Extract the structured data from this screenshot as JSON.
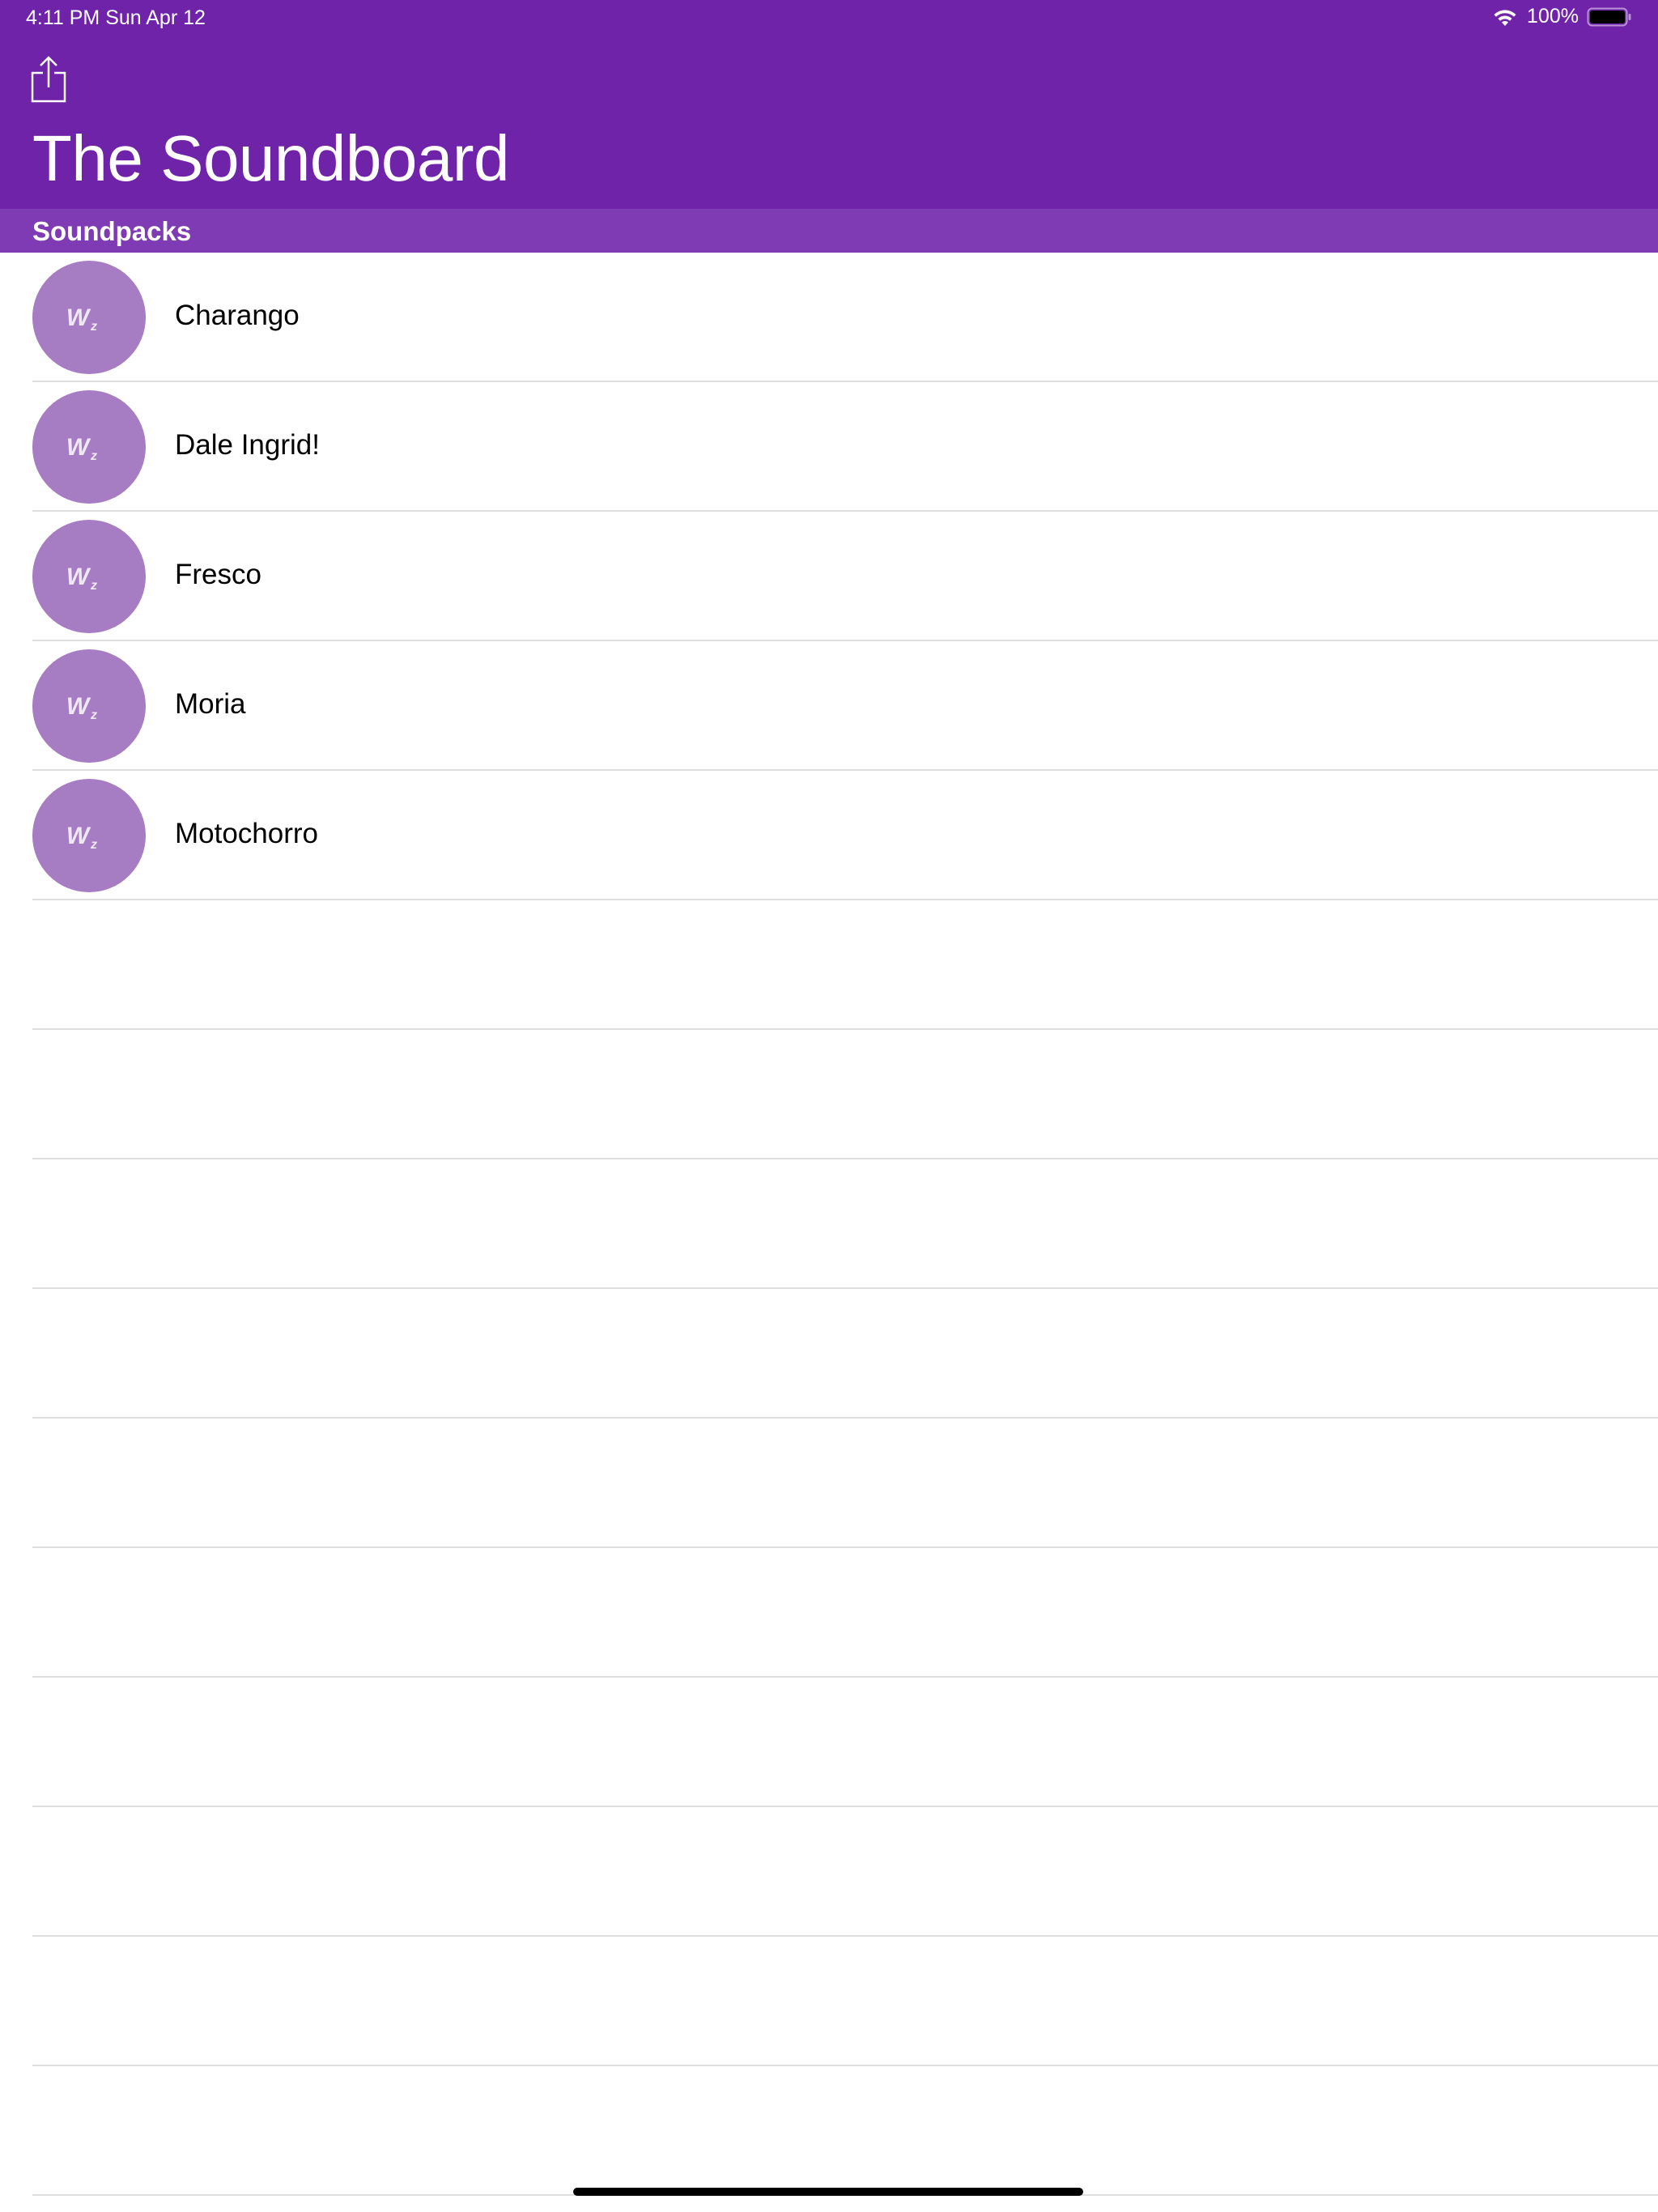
{
  "status_bar": {
    "time": "4:11 PM   Sun Apr 12",
    "battery": "100%"
  },
  "header": {
    "title": "The Soundboard",
    "share_icon": "share-icon"
  },
  "section": {
    "title": "Soundpacks"
  },
  "soundpacks": [
    {
      "label": "Charango",
      "icon": "soundpack-logo-icon"
    },
    {
      "label": "Dale Ingrid!",
      "icon": "soundpack-logo-icon"
    },
    {
      "label": "Fresco",
      "icon": "soundpack-logo-icon"
    },
    {
      "label": "Moria",
      "icon": "soundpack-logo-icon"
    },
    {
      "label": "Motochorro",
      "icon": "soundpack-logo-icon"
    }
  ],
  "colors": {
    "header_bg": "#6f23a9",
    "section_bg": "#7e3bb3",
    "avatar_bg": "#a67cc2"
  }
}
